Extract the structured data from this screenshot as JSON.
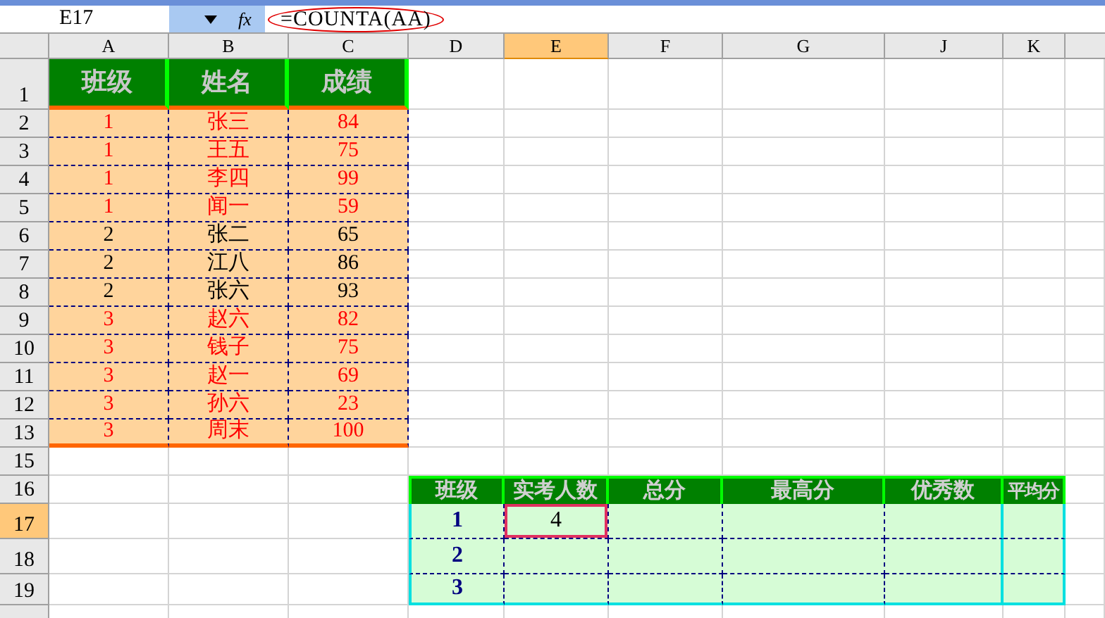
{
  "name_box": "E17",
  "fx": "fx",
  "formula": "=COUNTA(AA)",
  "columns": [
    {
      "label": "A",
      "selected": false
    },
    {
      "label": "B",
      "selected": false
    },
    {
      "label": "C",
      "selected": false
    },
    {
      "label": "D",
      "selected": false
    },
    {
      "label": "E",
      "selected": true
    },
    {
      "label": "F",
      "selected": false
    },
    {
      "label": "G",
      "selected": false
    },
    {
      "label": "J",
      "selected": false
    },
    {
      "label": "K",
      "selected": false
    }
  ],
  "rows": [
    {
      "number": "1",
      "selected": false,
      "kind": "score_header",
      "cells": [
        "班级",
        "姓名",
        "成绩"
      ]
    },
    {
      "number": "2",
      "selected": false,
      "kind": "score",
      "red_text": true,
      "cells": [
        "1",
        "张三",
        "84"
      ]
    },
    {
      "number": "3",
      "selected": false,
      "kind": "score",
      "red_text": true,
      "cells": [
        "1",
        "王五",
        "75"
      ]
    },
    {
      "number": "4",
      "selected": false,
      "kind": "score",
      "red_text": true,
      "cells": [
        "1",
        "李四",
        "99"
      ]
    },
    {
      "number": "5",
      "selected": false,
      "kind": "score",
      "red_text": true,
      "cells": [
        "1",
        "闻一",
        "59"
      ]
    },
    {
      "number": "6",
      "selected": false,
      "kind": "score",
      "red_text": false,
      "cells": [
        "2",
        "张二",
        "65"
      ]
    },
    {
      "number": "7",
      "selected": false,
      "kind": "score",
      "red_text": false,
      "cells": [
        "2",
        "江八",
        "86"
      ]
    },
    {
      "number": "8",
      "selected": false,
      "kind": "score",
      "red_text": false,
      "cells": [
        "2",
        "张六",
        "93"
      ]
    },
    {
      "number": "9",
      "selected": false,
      "kind": "score",
      "red_text": true,
      "cells": [
        "3",
        "赵六",
        "82"
      ]
    },
    {
      "number": "10",
      "selected": false,
      "kind": "score",
      "red_text": true,
      "cells": [
        "3",
        "钱子",
        "75"
      ]
    },
    {
      "number": "11",
      "selected": false,
      "kind": "score",
      "red_text": true,
      "cells": [
        "3",
        "赵一",
        "69"
      ]
    },
    {
      "number": "12",
      "selected": false,
      "kind": "score",
      "red_text": true,
      "cells": [
        "3",
        "孙六",
        "23"
      ]
    },
    {
      "number": "13",
      "selected": false,
      "kind": "score",
      "red_text": true,
      "cells": [
        "3",
        "周末",
        "100"
      ]
    },
    {
      "number": "15",
      "selected": false,
      "kind": "blank"
    },
    {
      "number": "16",
      "selected": false,
      "kind": "summary_header",
      "cells": [
        "班级",
        "实考人数",
        "总分",
        "最高分",
        "优秀数",
        "平均分"
      ]
    },
    {
      "number": "17",
      "selected": true,
      "kind": "summary",
      "cells": [
        {
          "text": "1",
          "selected": false
        },
        {
          "text": "4",
          "selected": true
        }
      ]
    },
    {
      "number": "18",
      "selected": false,
      "kind": "summary",
      "cells": [
        {
          "text": "2",
          "selected": false
        }
      ]
    },
    {
      "number": "19",
      "selected": false,
      "kind": "summary",
      "cells": [
        {
          "text": "3",
          "selected": false
        }
      ]
    }
  ]
}
